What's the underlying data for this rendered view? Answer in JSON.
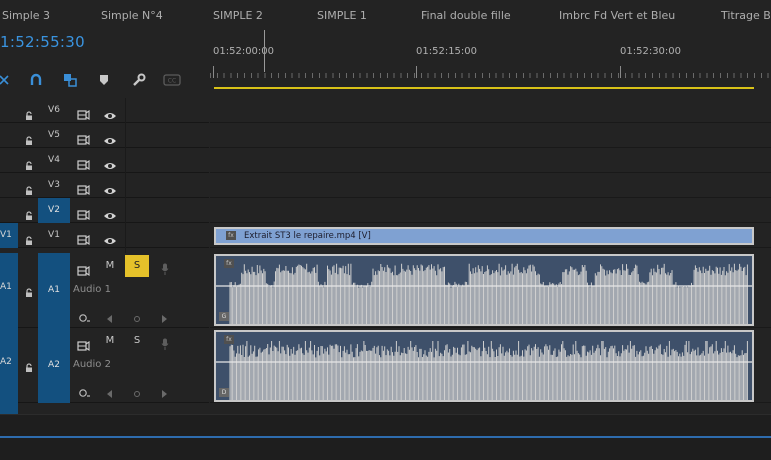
{
  "tabs": [
    "Simple 3",
    "Simple N°4",
    "SIMPLE 2",
    "SIMPLE 1",
    "Final double fille",
    "Imbrc Fd Vert et Bleu",
    "Titrage Ble"
  ],
  "timecode": "1:52:55:30",
  "ruler": {
    "labels": [
      "01:52:00:00",
      "01:52:15:00",
      "01:52:30:00"
    ]
  },
  "toolbar": {
    "icons": [
      "snap-icon",
      "magnet-icon",
      "linked-selection-icon",
      "marker-icon",
      "wrench-icon",
      "captions-icon"
    ]
  },
  "video_tracks": [
    {
      "label": "V6"
    },
    {
      "label": "V5"
    },
    {
      "label": "V4"
    },
    {
      "label": "V3"
    },
    {
      "label": "V2",
      "selected": true
    },
    {
      "label": "V1",
      "source": "V1"
    }
  ],
  "audio_tracks": [
    {
      "label": "A1",
      "source": "A1",
      "name": "Audio 1",
      "m": "M",
      "s": "S",
      "solo": true
    },
    {
      "label": "A2",
      "source": "A2",
      "name": "Audio 2",
      "m": "M",
      "s": "S",
      "solo": false
    }
  ],
  "clips": {
    "video_clip_name": "Extrait ST3 le repaire.mp4 [V]",
    "fx_badge": "fx",
    "audio1_badge": "G",
    "audio2_badge": "D"
  },
  "colors": {
    "timecode": "#3a94e0",
    "source_patch": "#13507f",
    "solo_active": "#e5c12a",
    "work_area": "#d8c218",
    "video_clip": "#7fa1d2",
    "audio_clip": "#3e506a"
  }
}
